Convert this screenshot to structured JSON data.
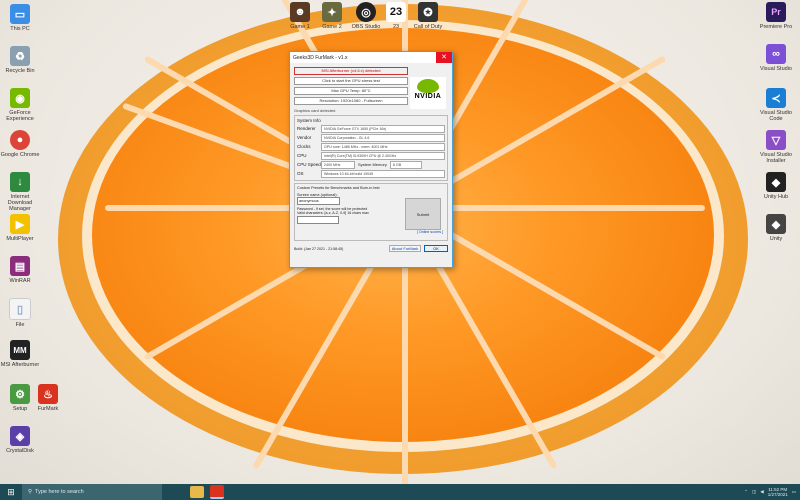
{
  "window": {
    "title": "Geeks3D FurMark - v1.x",
    "close_label": "✕",
    "red_line": "MSI Afterburner (v4.6.x) detected",
    "box1": "Click to start the GPU stress test",
    "box2": "Max GPU Temp: 80°C",
    "box3": "Resolution: 1920x1080 - Fullscreen",
    "info_line": "Graphics card detected",
    "system_info_label": "System Info",
    "rows": [
      {
        "key": "Renderer",
        "value": "NVIDIA GeForce GTX 1650 (PCIe 16x)"
      },
      {
        "key": "Vendor",
        "value": "NVIDIA Corporation - GL 4.6"
      },
      {
        "key": "Clocks",
        "value": "GPU core: 1485 MHz - mem: 4001 MHz"
      },
      {
        "key": "CPU",
        "value": "Intel(R) Core(TM) i5-9300H CPU @ 2.40GHz"
      },
      {
        "key": "CPU Speed",
        "value": "2400 MHz"
      },
      {
        "key": "OS",
        "value": "Windows 10 64-bit build 19045"
      }
    ],
    "system_memory_label": "System Memory",
    "system_memory_value": "8 GB",
    "benchmark_header": "Custom Presets for Benchmarks and Burn-in test",
    "screen_name_label": "Screen name (optional):",
    "screen_name_value": "anonymous",
    "password_label": "Password - if set, the score will be protected",
    "valid_chars_label": "Valid characters: [a-z, A-Z, 0-9] 16 chars max",
    "submit_label": "Submit",
    "link_label": "[ Online scores ]",
    "build_label": "Build: (Jan 27 2021 - 21:58:45)",
    "about_label": "About FurMark",
    "ok_label": "OK",
    "nvidia_label": "NVIDIA"
  },
  "desktop_icons": [
    {
      "label": "This PC",
      "icon": "pc-icon",
      "color": "#3a8ee6"
    },
    {
      "label": "Recycle Bin",
      "icon": "recycle-bin-icon",
      "color": "#8aa0b0"
    },
    {
      "label": "GeForce Experience",
      "icon": "geforce-icon",
      "color": "#76b900"
    },
    {
      "label": "Google Chrome",
      "icon": "chrome-icon",
      "color": "#db4437"
    },
    {
      "label": "Internet Download Manager",
      "icon": "idm-icon",
      "color": "#2d8a3e"
    },
    {
      "label": "MultiPlayer",
      "icon": "player-icon",
      "color": "#f2c200"
    },
    {
      "label": "WinRAR",
      "icon": "winrar-icon",
      "color": "#8b2d7d"
    },
    {
      "label": "File",
      "icon": "file-icon",
      "color": "#8fa8c8"
    },
    {
      "label": "MSI Afterburner",
      "icon": "afterburner-icon",
      "color": "#222222"
    },
    {
      "label": "Setup",
      "icon": "setup-icon",
      "color": "#4a9a44"
    },
    {
      "label": "FurMark",
      "icon": "furmark-icon",
      "color": "#d9321f"
    },
    {
      "label": "CrystalDisk",
      "icon": "disk-icon",
      "color": "#5b3fa8"
    },
    {
      "label": "Premiere Pro",
      "icon": "premiere-icon",
      "color": "#2a1b5a"
    },
    {
      "label": "Visual Studio",
      "icon": "visual-studio-icon",
      "color": "#7b4fd6"
    },
    {
      "label": "Visual Studio Code",
      "icon": "vscode-icon",
      "color": "#1a7fd4"
    },
    {
      "label": "Visual Studio Installer",
      "icon": "vs-installer-icon",
      "color": "#8a4fc6"
    },
    {
      "label": "Unity Hub",
      "icon": "unity-hub-icon",
      "color": "#222222"
    },
    {
      "label": "Unity",
      "icon": "unity-icon",
      "color": "#444444"
    },
    {
      "label": "Game 1",
      "icon": "game-icon-1",
      "color": "#5a3a22"
    },
    {
      "label": "Game 2",
      "icon": "game-icon-2",
      "color": "#6a6a40"
    },
    {
      "label": "OBS Studio",
      "icon": "obs-icon",
      "color": "#222222"
    },
    {
      "label": "23",
      "icon": "game-23-icon",
      "color": "#ffffff"
    },
    {
      "label": "Call of Duty",
      "icon": "cod-icon",
      "color": "#333333"
    }
  ],
  "taskbar": {
    "start_label": "⊞",
    "search_placeholder": "Type here to search",
    "time": "11:52 PM",
    "date": "1/27/2021"
  },
  "colors": {
    "accent": "#76b900",
    "taskbar": "#1d4a54"
  }
}
